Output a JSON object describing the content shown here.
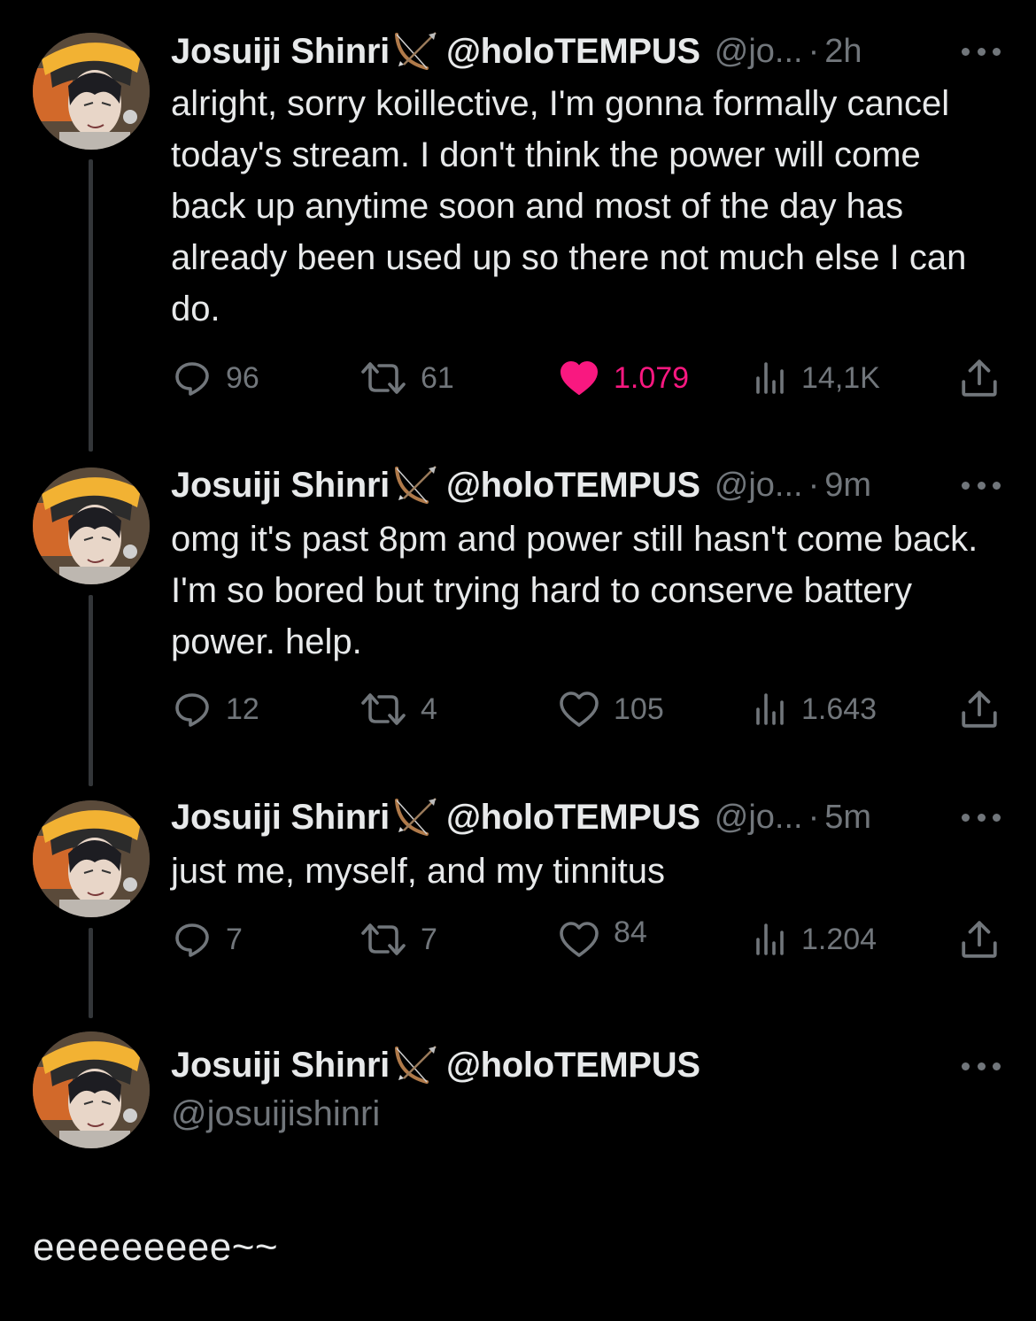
{
  "author": {
    "name": "Josuiji Shinri",
    "display_handle": "@holoTEMPUS",
    "truncated_handle": "@jo...",
    "full_handle": "@josuijishinri"
  },
  "tweets": [
    {
      "time": "2h",
      "text": "alright, sorry koillective, I'm gonna formally cancel today's stream. I don't think the power will come back up anytime soon and most of the day has already been used up so there not much else I can do.",
      "replies": "96",
      "retweets": "61",
      "likes": "1.079",
      "liked": true,
      "views": "14,1K"
    },
    {
      "time": "9m",
      "text": "omg it's past 8pm and power still hasn't come back. I'm so bored but trying hard to conserve battery power. help.",
      "replies": "12",
      "retweets": "4",
      "likes": "105",
      "liked": false,
      "views": "1.643"
    },
    {
      "time": "5m",
      "text": "just me, myself, and my tinnitus",
      "replies": "7",
      "retweets": "7",
      "likes": "84",
      "liked": false,
      "views": "1.204"
    }
  ],
  "last_tweet": {
    "text": "eeeeeeeee~~"
  },
  "colors": {
    "background": "#000000",
    "text": "#e7e9ea",
    "secondary": "#71767b",
    "like_active": "#f91880",
    "thread_line": "#333639"
  },
  "icons": [
    "reply-icon",
    "retweet-icon",
    "heart-icon",
    "views-icon",
    "share-icon",
    "more-icon",
    "bow-and-arrow-icon"
  ]
}
